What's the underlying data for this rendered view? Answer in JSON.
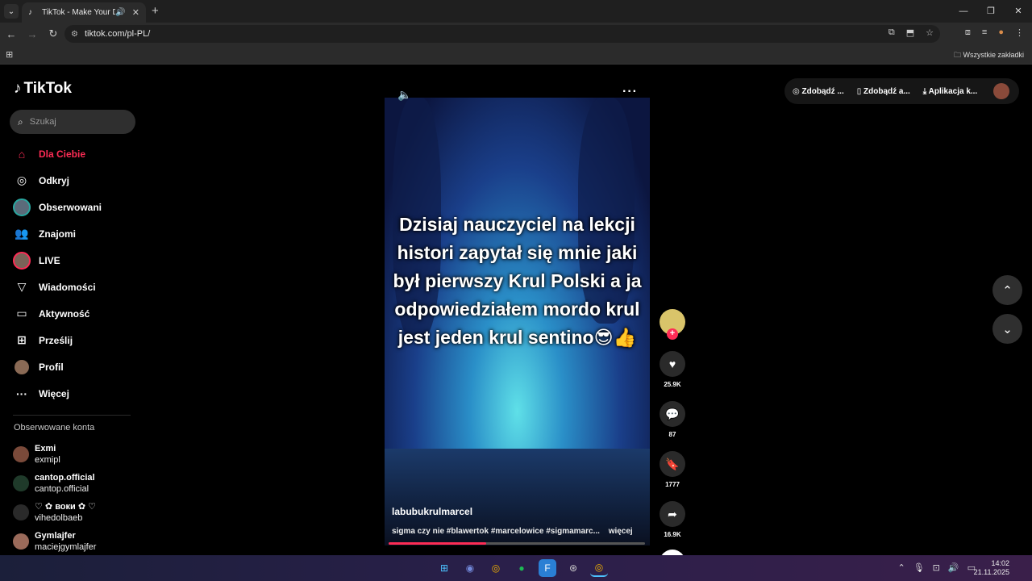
{
  "browser": {
    "tab_title": "TikTok - Make Your Day",
    "url": "tiktok.com/pl-PL/",
    "bookmarks_all": "Wszystkie zakładki"
  },
  "sidebar": {
    "logo": "TikTok",
    "search_placeholder": "Szukaj",
    "items": [
      {
        "label": "Dla Ciebie",
        "icon": "home-icon"
      },
      {
        "label": "Odkryj",
        "icon": "compass-icon"
      },
      {
        "label": "Obserwowani",
        "icon": "following-avatar"
      },
      {
        "label": "Znajomi",
        "icon": "friends-icon"
      },
      {
        "label": "LIVE",
        "icon": "live-avatar"
      },
      {
        "label": "Wiadomości",
        "icon": "send-icon"
      },
      {
        "label": "Aktywność",
        "icon": "activity-icon"
      },
      {
        "label": "Prześlij",
        "icon": "upload-icon"
      },
      {
        "label": "Profil",
        "icon": "profile-avatar"
      },
      {
        "label": "Więcej",
        "icon": "more-icon"
      }
    ],
    "followed_title": "Obserwowane konta",
    "followed": [
      {
        "name": "Exmi",
        "user": "exmipl",
        "color": "#7a4a3a"
      },
      {
        "name": "cantop.official",
        "user": "cantop.official",
        "color": "#1f3a2a"
      },
      {
        "name": "♡ ✿ воки ✿ ♡",
        "user": "vihedolbaeb",
        "color": "#2a2a2a"
      },
      {
        "name": "Gymlajfer",
        "user": "maciejgymlajfer",
        "color": "#9a6a5a"
      }
    ]
  },
  "video": {
    "caption": "Dzisiaj nauczyciel na lekcji histori zapytał się mnie jaki był pierwszy Krul Polski a ja odpowiedziałem mordo krul jest jeden krul sentino😎👍",
    "author": "labubukrulmarcel",
    "description": "sigma czy nie #blawertok #marcelowice #sigmamarc...",
    "more_label": "więcej",
    "progress": 0.38
  },
  "actions": {
    "likes": "25.9K",
    "comments": "87",
    "saves": "1777",
    "shares": "16.9K"
  },
  "topbar": {
    "items": [
      "Zdobądź ...",
      "Zdobądź a...",
      "Aplikacja k..."
    ]
  },
  "taskbar": {
    "time": "14:02",
    "date": "21.11.2025"
  }
}
